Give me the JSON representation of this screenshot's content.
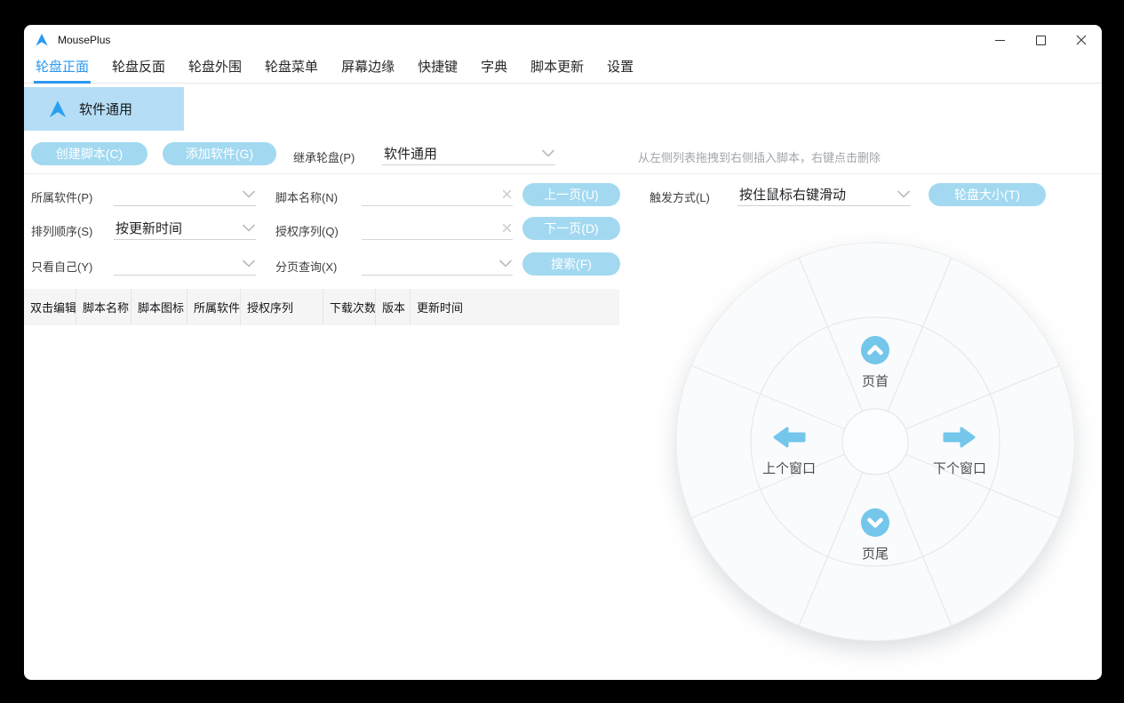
{
  "window": {
    "title": "MousePlus"
  },
  "tabs": [
    {
      "label": "轮盘正面",
      "active": true
    },
    {
      "label": "轮盘反面"
    },
    {
      "label": "轮盘外围"
    },
    {
      "label": "轮盘菜单"
    },
    {
      "label": "屏幕边缘"
    },
    {
      "label": "快捷键"
    },
    {
      "label": "字典"
    },
    {
      "label": "脚本更新"
    },
    {
      "label": "设置"
    }
  ],
  "selected_app": {
    "label": "软件通用"
  },
  "toolbar": {
    "create_script_label": "创建脚本(C)",
    "add_software_label": "添加软件(G)",
    "inherit_wheel_label": "继承轮盘(P)",
    "inherit_wheel_value": "软件通用",
    "drag_hint": "从左侧列表拖拽到右侧插入脚本，右键点击删除"
  },
  "filters": {
    "owner_label": "所属软件(P)",
    "script_name_label": "脚本名称(N)",
    "prev_page_label": "上一页(U)",
    "trigger_label": "触发方式(L)",
    "trigger_value": "按住鼠标右键滑动",
    "wheel_size_label": "轮盘大小(T)",
    "sort_label": "排列顺序(S)",
    "sort_value": "按更新时间",
    "auth_label": "授权序列(Q)",
    "next_page_label": "下一页(D)",
    "only_mine_label": "只看自己(Y)",
    "page_query_label": "分页查询(X)",
    "search_label": "搜索(F)"
  },
  "table": {
    "headers": [
      "双击编辑",
      "脚本名称",
      "脚本图标",
      "所属软件",
      "授权序列",
      "下载次数",
      "版本",
      "更新时间"
    ]
  },
  "wheel": {
    "up": {
      "label": "页首"
    },
    "right": {
      "label": "下个窗口"
    },
    "down": {
      "label": "页尾"
    },
    "left": {
      "label": "上个窗口"
    }
  },
  "icons": {
    "logo": "blue-triangle-cursor",
    "app_item": "blue-triangle-cursor",
    "minimize": "horizontal-line",
    "maximize": "square-outline",
    "close": "x-cross",
    "dropdown": "chevron-down",
    "clear": "x-cross",
    "wheel_up": "chevron-up-circle",
    "wheel_down": "chevron-down-circle",
    "wheel_left": "arrow-left",
    "wheel_right": "arrow-right"
  },
  "colors": {
    "stage_bg": "#000000",
    "window_bg": "#ffffff",
    "accent_blue": "#2b99f0",
    "pill_button_blue": "#a2d9f1",
    "selected_item_blue": "#b5def6",
    "wheel_icon_blue": "#74c6ea",
    "hint_gray": "#a2a6ab"
  }
}
